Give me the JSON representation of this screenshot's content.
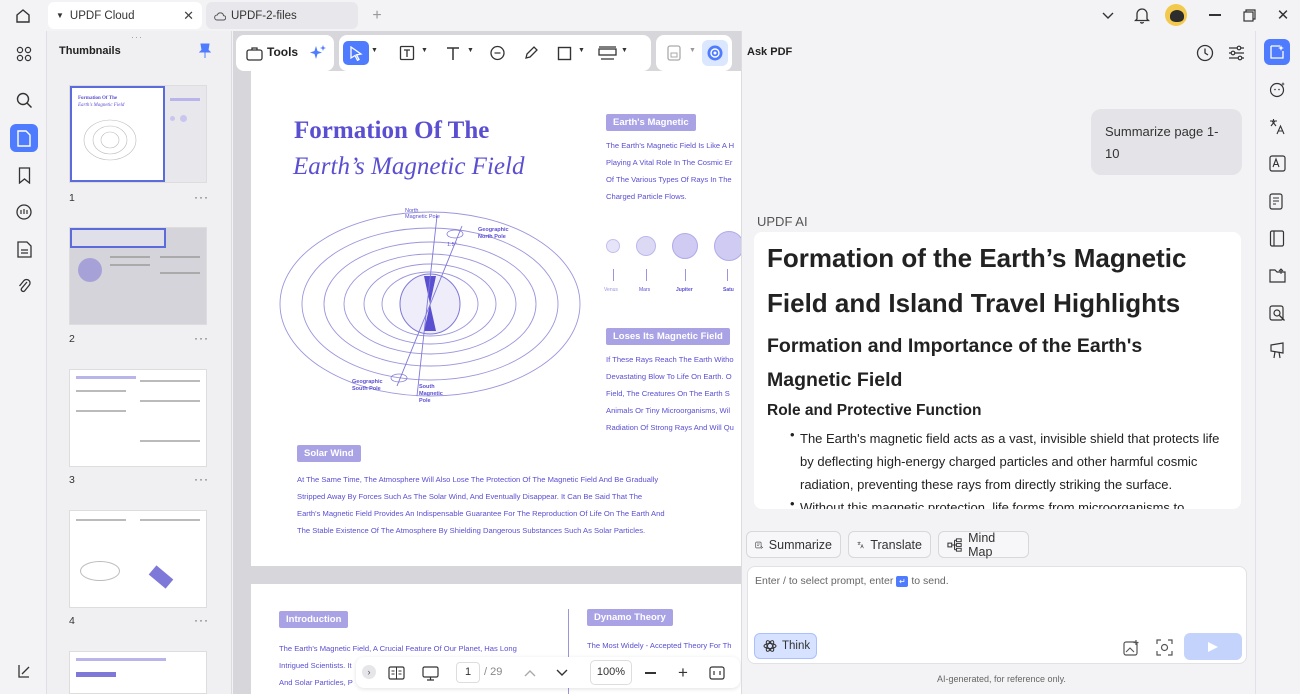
{
  "titlebar": {
    "tabs": [
      {
        "label": "UPDF Cloud"
      },
      {
        "label": "UPDF-2-files"
      }
    ]
  },
  "thumbnails": {
    "title": "Thumbnails",
    "pages": [
      "1",
      "2",
      "3",
      "4"
    ],
    "dots": "···"
  },
  "toolbar": {
    "tools_label": "Tools"
  },
  "page1": {
    "title1": "Formation Of The",
    "title2": "Earth’s Magnetic Field",
    "north_label": "North\nMagnetic Pole",
    "geo_north": "Geographic\nNorth Pole",
    "angle": "1.5°",
    "geo_south": "Geographic\nSouth Pole",
    "south_mag": "South\nMagnetic\nPole",
    "earth_mag_pill": "Earth's Magnetic",
    "earth_mag_lines": [
      "The Earth's Magnetic Field Is Like A H",
      "Playing A Vital Role In The Cosmic Er",
      "Of The Various Types Of Rays In The",
      "Charged Particle Flows."
    ],
    "planets": [
      "Venus",
      "Mars",
      "Jupiter",
      "Satu"
    ],
    "loses_pill": "Loses Its Magnetic Field",
    "loses_lines": [
      "If These Rays Reach The Earth Witho",
      "Devastating Blow To Life On Earth. O",
      "Field, The Creatures On The Earth S",
      "Animals Or Tiny Microorganisms, Wil",
      "Radiation Of Strong Rays And Will Qu"
    ],
    "solar_pill": "Solar Wind",
    "solar_lines": [
      "At The Same Time, The Atmosphere Will Also Lose The Protection Of The Magnetic Field And Be Gradually",
      "Stripped Away By Forces Such As The Solar Wind, And Eventually Disappear. It Can Be Said That The",
      "Earth's Magnetic Field Provides An Indispensable Guarantee For The Reproduction Of Life On The Earth And",
      "The Stable Existence Of The Atmosphere By Shielding Dangerous Substances Such As Solar Particles."
    ]
  },
  "page2": {
    "intro_pill": "Introduction",
    "intro_lines": [
      "The Earth's Magnetic Field, A Crucial Feature Of Our Planet, Has Long",
      "Intrigued Scientists. It",
      "And Solar Particles, P"
    ],
    "dynamo_pill": "Dynamo Theory",
    "dynamo_lines": [
      "The Most Widely - Accepted Theory For Th"
    ]
  },
  "bottombar": {
    "page": "1",
    "total": "/ 29",
    "zoom": "100%"
  },
  "ask": {
    "title": "Ask PDF",
    "user_msg": "Summarize page 1-10",
    "ai_label": "UPDF AI",
    "h1": "Formation of the Earth’s Magnetic Field and Island Travel Highlights",
    "h2": "Formation and Importance of the Earth's Magnetic Field",
    "h3": "Role and Protective Function",
    "bullet1": "The Earth's magnetic field acts as a vast, invisible shield that protects life by deflecting high-energy charged particles and other harmful cosmic radiation, preventing these rays from directly striking the surface.",
    "bullet2": "Without this magnetic protection, life forms from microorganisms to",
    "chips": [
      "Summarize",
      "Translate",
      "Mind Map"
    ],
    "input_placeholder_a": "Enter / to select prompt, enter",
    "input_placeholder_b": "to send.",
    "think": "Think",
    "footer": "AI-generated, for reference only."
  },
  "colors": {
    "accent": "#5b4fd1",
    "pill": "#a9a3e6",
    "active_blue": "#4f7cff"
  }
}
